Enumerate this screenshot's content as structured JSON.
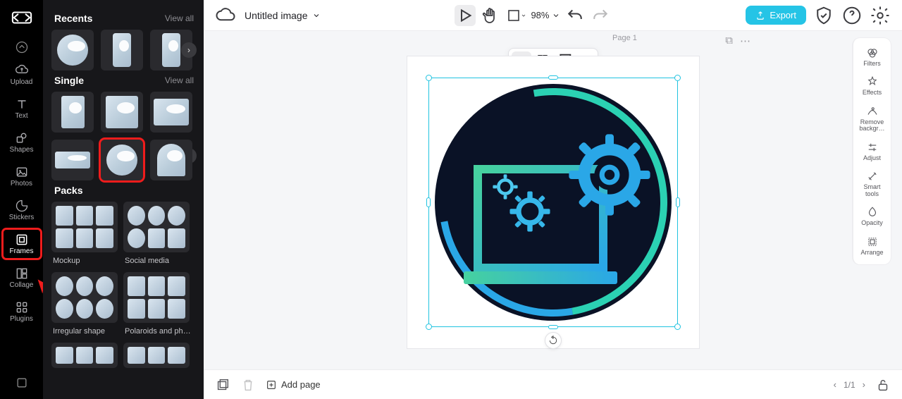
{
  "topbar": {
    "doc_title": "Untitled image",
    "zoom": "98%",
    "export_label": "Export"
  },
  "nav": {
    "upload": "Upload",
    "text": "Text",
    "shapes": "Shapes",
    "photos": "Photos",
    "stickers": "Stickers",
    "frames": "Frames",
    "collage": "Collage",
    "plugins": "Plugins"
  },
  "panel": {
    "recents_title": "Recents",
    "single_title": "Single",
    "packs_title": "Packs",
    "viewall": "View all",
    "pack_labels": {
      "mockup": "Mockup",
      "social": "Social media",
      "irregular": "Irregular shape",
      "polaroids": "Polaroids and photo …"
    }
  },
  "canvas": {
    "page_label": "Page 1"
  },
  "right_panel": {
    "filters": "Filters",
    "effects": "Effects",
    "remove_bg": "Remove backgr…",
    "adjust": "Adjust",
    "smart_tools": "Smart tools",
    "opacity": "Opacity",
    "arrange": "Arrange"
  },
  "footer": {
    "add_page": "Add page",
    "pager": "1/1"
  }
}
